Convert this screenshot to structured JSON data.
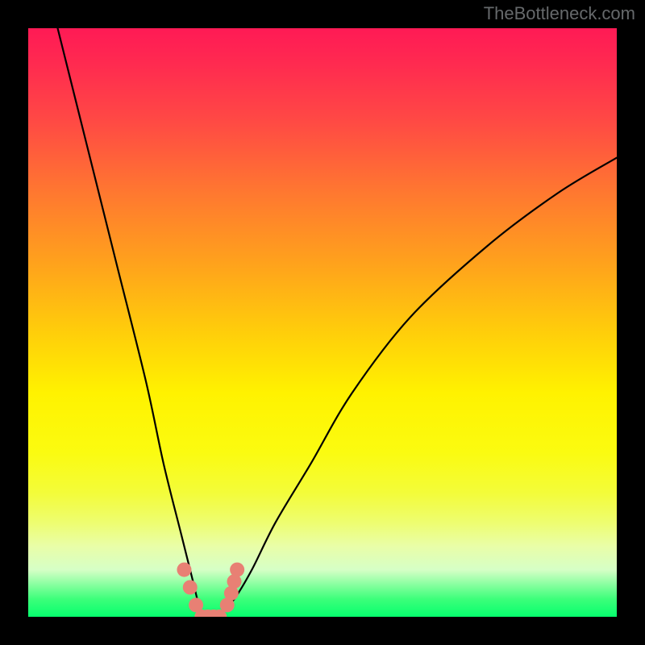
{
  "watermark": "TheBottleneck.com",
  "chart_data": {
    "type": "line",
    "title": "",
    "xlabel": "",
    "ylabel": "",
    "xlim": [
      0,
      100
    ],
    "ylim": [
      0,
      100
    ],
    "series": [
      {
        "name": "bottleneck-curve",
        "x": [
          5,
          10,
          15,
          20,
          23,
          26,
          28,
          29,
          30,
          31,
          32,
          33,
          35,
          38,
          42,
          48,
          55,
          65,
          78,
          90,
          100
        ],
        "values": [
          100,
          80,
          60,
          40,
          26,
          14,
          6,
          2,
          0,
          0,
          0,
          1,
          3,
          8,
          16,
          26,
          38,
          51,
          63,
          72,
          78
        ]
      }
    ],
    "markers": {
      "name": "highlight-dots",
      "color": "#e88074",
      "x": [
        26.5,
        27.5,
        28.5,
        29.5,
        30.5,
        31.5,
        32.5,
        33.8,
        34.5,
        35.0,
        35.5
      ],
      "values": [
        8,
        5,
        2,
        0,
        0,
        0,
        0,
        2,
        4,
        6,
        8
      ]
    },
    "gradient_stops": [
      {
        "pos": 0,
        "color": "#ff1a55"
      },
      {
        "pos": 6,
        "color": "#ff2a50"
      },
      {
        "pos": 16,
        "color": "#ff4a44"
      },
      {
        "pos": 28,
        "color": "#ff7830"
      },
      {
        "pos": 40,
        "color": "#ffa21c"
      },
      {
        "pos": 52,
        "color": "#ffcf0a"
      },
      {
        "pos": 62,
        "color": "#fff200"
      },
      {
        "pos": 72,
        "color": "#fbfb10"
      },
      {
        "pos": 79,
        "color": "#f3fc3a"
      },
      {
        "pos": 84,
        "color": "#eefd70"
      },
      {
        "pos": 88,
        "color": "#e9fea8"
      },
      {
        "pos": 92,
        "color": "#d6ffc6"
      },
      {
        "pos": 97,
        "color": "#3cff7a"
      },
      {
        "pos": 100,
        "color": "#06ff6e"
      }
    ]
  }
}
